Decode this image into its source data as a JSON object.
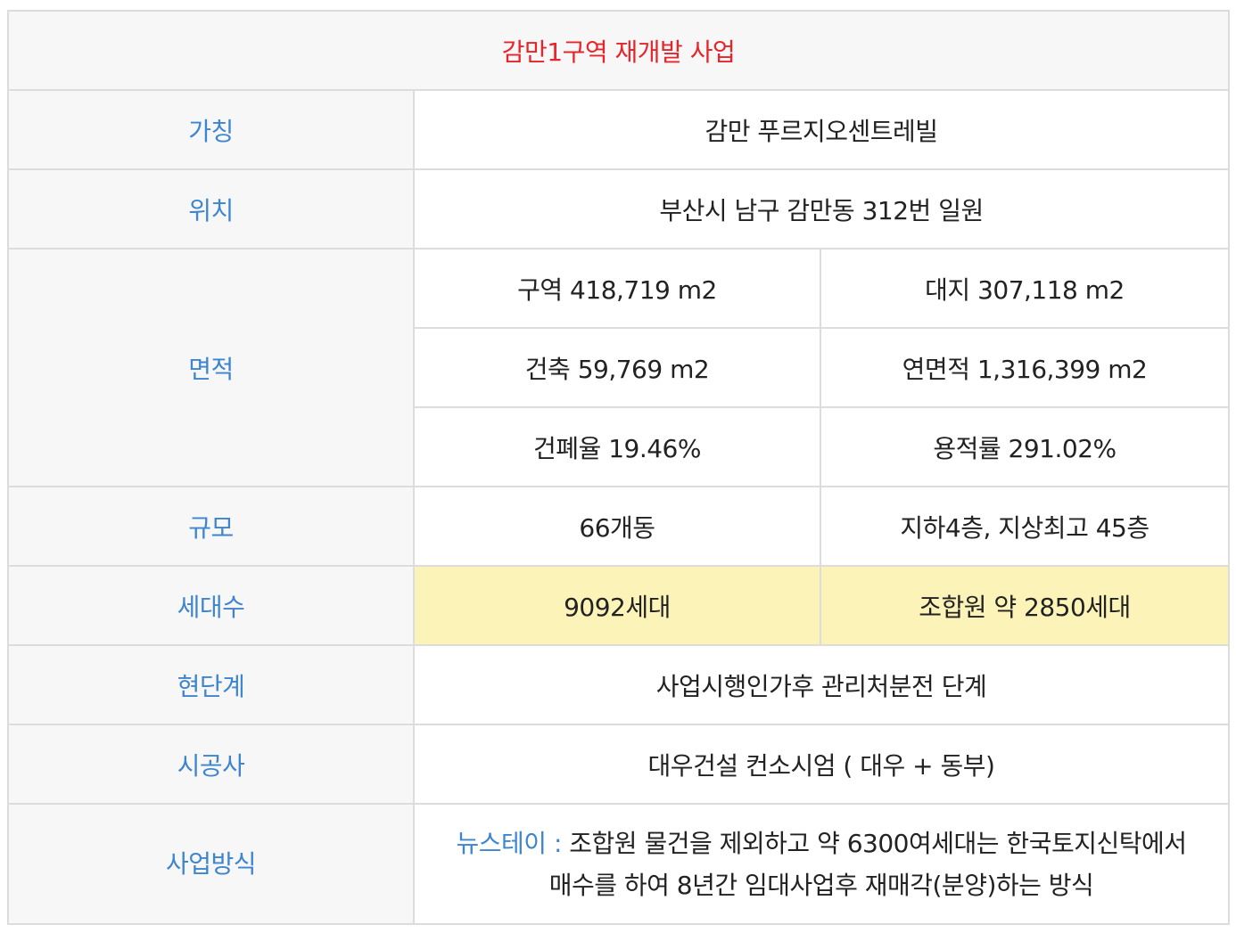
{
  "title": "감만1구역 재개발 사업",
  "rows": {
    "name": {
      "label": "가칭",
      "value": "감만 푸르지오센트레빌"
    },
    "location": {
      "label": "위치",
      "value": "부산시 남구 감만동 312번 일원"
    },
    "area": {
      "label": "면적",
      "zone": "구역 418,719 m2",
      "site": "대지 307,118 m2",
      "building": "건축 59,769 m2",
      "total_floor": "연면적 1,316,399 m2",
      "coverage": "건폐율 19.46%",
      "far": "용적률 291.02%"
    },
    "scale": {
      "label": "규모",
      "buildings": "66개동",
      "floors": "지하4층, 지상최고 45층"
    },
    "households": {
      "label": "세대수",
      "total": "9092세대",
      "members": "조합원 약 2850세대"
    },
    "stage": {
      "label": "현단계",
      "value": "사업시행인가후 관리처분전 단계"
    },
    "builder": {
      "label": "시공사",
      "value": "대우건설 컨소시엄 ( 대우 + 동부)"
    },
    "method": {
      "label": "사업방식",
      "term": "뉴스테이 :",
      "line1": " 조합원 물건을 제외하고 약 6300여세대는 한국토지신탁에서",
      "line2": "매수를 하여 8년간 임대사업후 재매각(분양)하는 방식"
    }
  },
  "colors": {
    "title": "#e8242b",
    "label": "#3d86cf",
    "highlight": "#fcf3b8",
    "label_bg": "#f7f7f7",
    "border": "#dcdcdc"
  }
}
